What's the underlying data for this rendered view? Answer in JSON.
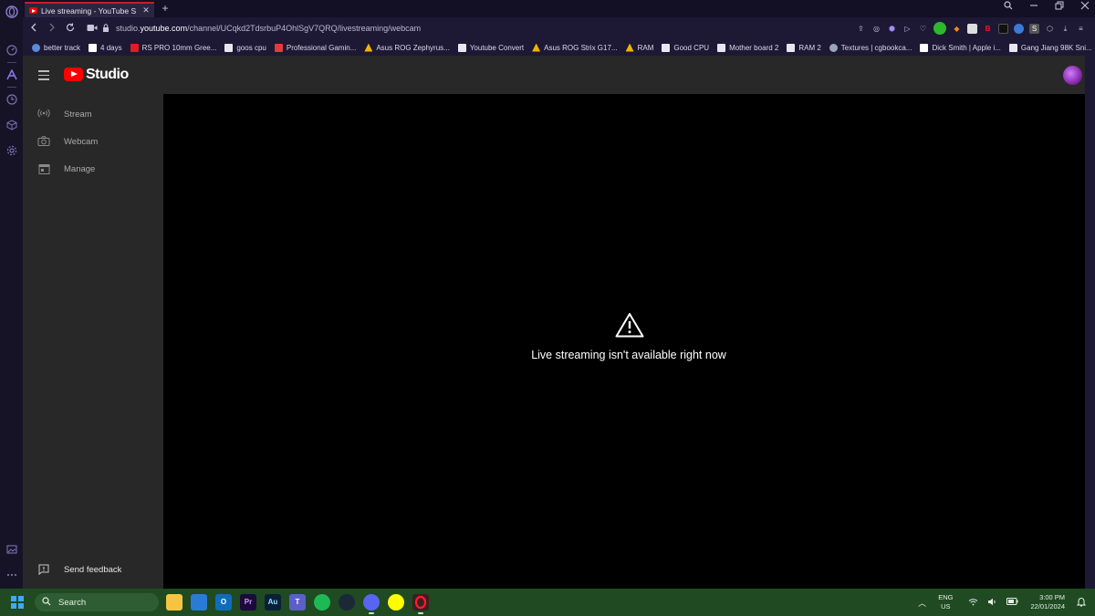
{
  "browser": {
    "tab_title": "Live streaming - YouTube S",
    "new_tab_label": "+",
    "url_prefix": "studio.",
    "url_domain": "youtube.com",
    "url_path": "/channel/UCqkd2TdsrbuP4OhlSgV7QRQ/livestreaming/webcam"
  },
  "bookmarks": [
    "better track",
    "4 days",
    "RS PRO 10mm Gree...",
    "goos cpu",
    "Professional Gamin...",
    "Asus ROG Zephyrus...",
    "Youtube Convert",
    "Asus ROG Strix G17...",
    "RAM",
    "Good CPU",
    "Mother board 2",
    "RAM 2",
    "Textures | cgbookca...",
    "Dick Smith | Apple i...",
    "Gang Jiang 98K Sni..."
  ],
  "studio": {
    "logo_text": "Studio",
    "nav": [
      {
        "label": "Stream",
        "icon": "broadcast-icon"
      },
      {
        "label": "Webcam",
        "icon": "camera-icon"
      },
      {
        "label": "Manage",
        "icon": "calendar-icon"
      }
    ],
    "feedback_label": "Send feedback"
  },
  "main": {
    "message": "Live streaming isn't available right now",
    "icon": "warning-icon"
  },
  "taskbar": {
    "search_placeholder": "Search",
    "apps": [
      "file-explorer",
      "mail",
      "outlook",
      "premiere-pro",
      "audition",
      "teams",
      "spotify",
      "steam",
      "discord",
      "snapchat",
      "opera"
    ],
    "premiere_label": "Pr",
    "audition_label": "Au",
    "lang": "ENG",
    "region": "US",
    "time": "3:00 PM",
    "date": "22/01/2024"
  },
  "colors": {
    "browser_bg": "#1d1834",
    "studio_bg": "#282828",
    "taskbar_bg": "#1f4a22",
    "youtube_red": "#ff0000"
  }
}
